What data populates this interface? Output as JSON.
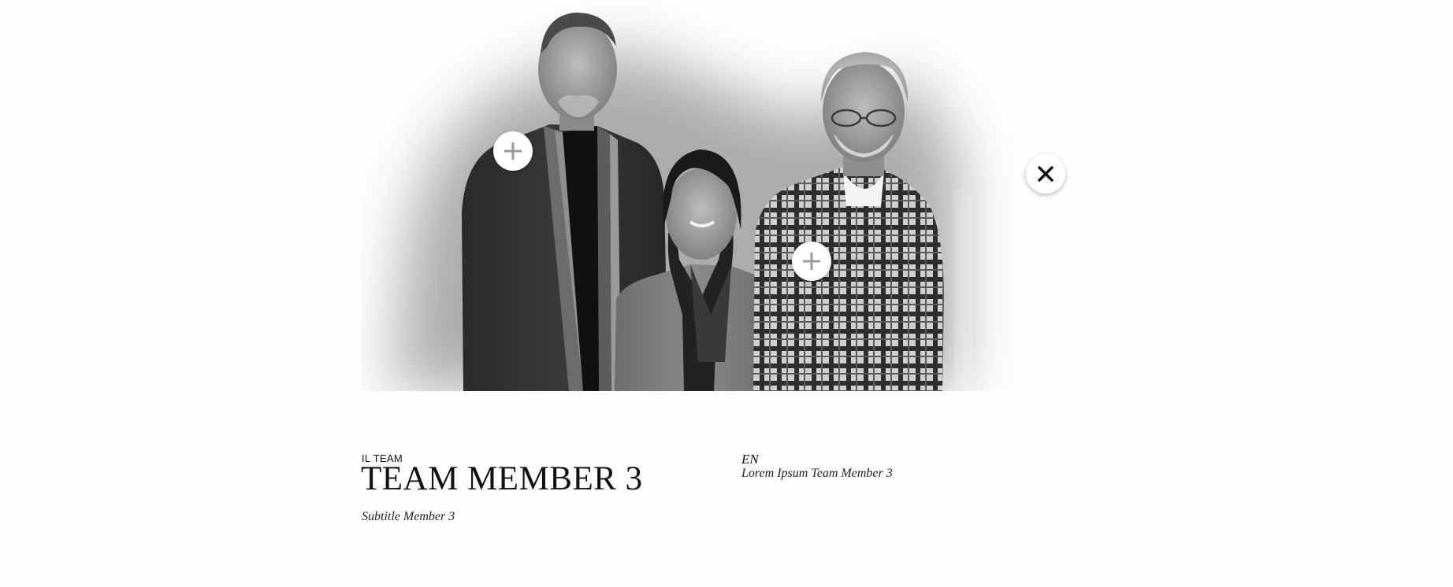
{
  "team": {
    "section_label": "IL TEAM",
    "member_title": "TEAM MEMBER 3",
    "member_subtitle": "Subtitle Member 3",
    "language": "EN",
    "bio_text": "Lorem Ipsum Team Member 3"
  },
  "hotspots": [
    {
      "icon": "plus-icon",
      "state": "closed"
    },
    {
      "icon": "plus-icon",
      "state": "closed"
    },
    {
      "icon": "close-icon",
      "state": "open"
    }
  ],
  "colors": {
    "background": "#fefefe",
    "text": "#111111",
    "hotspot_plus": "#9a9a9a",
    "hotspot_close": "#111111"
  }
}
